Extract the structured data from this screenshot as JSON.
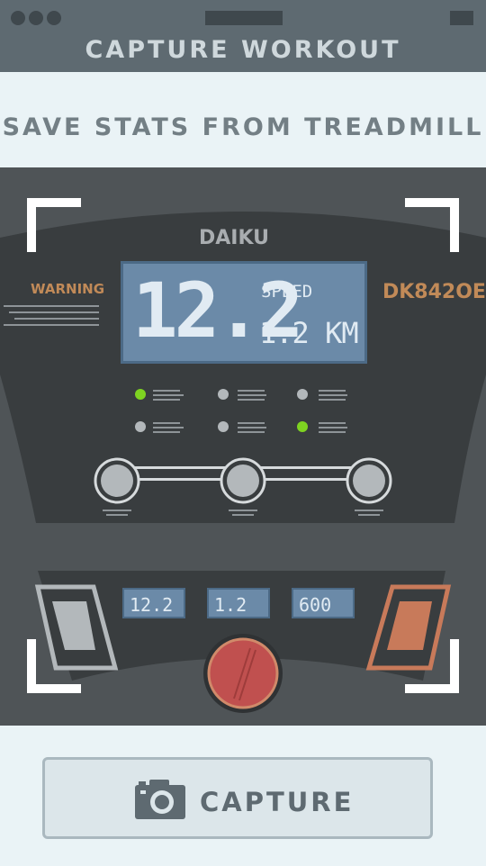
{
  "header": {
    "title": "CAPTURE WORKOUT"
  },
  "subtitle": "SAVE STATS FROM TREADMILL",
  "treadmill": {
    "brand": "DAIKU",
    "warning": "WARNING",
    "model": "DK842OE",
    "display": {
      "speed_value": "12.2",
      "speed_label": "SPEED",
      "distance": "1.2 KM"
    },
    "mini_displays": [
      "12.2",
      "1.2",
      "600"
    ],
    "indicator_colors": {
      "active": "#7ed321",
      "inactive": "#b3b8bb"
    }
  },
  "capture": {
    "label": "CAPTURE",
    "icon": "camera-icon"
  },
  "colors": {
    "header": "#5e6a71",
    "accent_orange": "#c18a58",
    "lcd": "#6b8aa8"
  }
}
